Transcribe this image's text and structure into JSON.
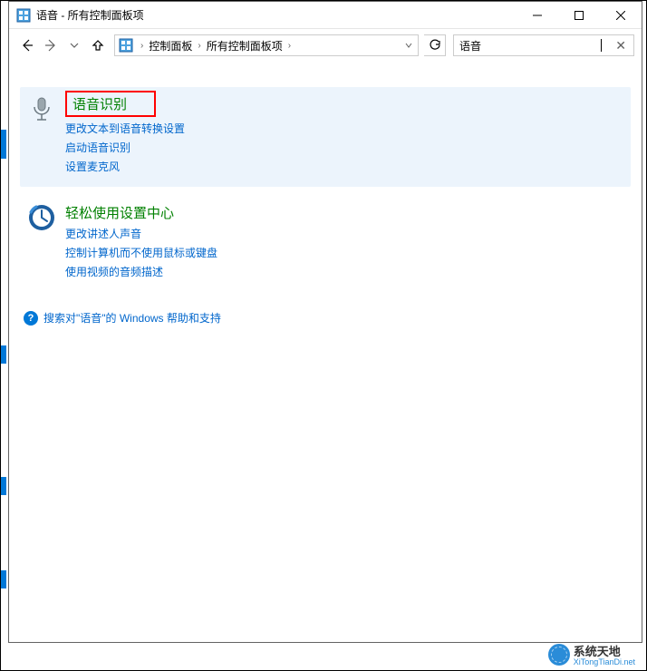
{
  "window": {
    "title": "语音 - 所有控制面板项"
  },
  "nav": {
    "crumbs": [
      "控制面板",
      "所有控制面板项"
    ],
    "search_value": "语音"
  },
  "results": [
    {
      "id": "speech-recognition",
      "title": "语音识别",
      "highlighted": true,
      "title_boxed": true,
      "icon": "microphone",
      "links": [
        "更改文本到语音转换设置",
        "启动语音识别",
        "设置麦克风"
      ]
    },
    {
      "id": "ease-of-access",
      "title": "轻松使用设置中心",
      "highlighted": false,
      "title_boxed": false,
      "icon": "ease-clock",
      "links": [
        "更改讲述人声音",
        "控制计算机而不使用鼠标或键盘",
        "使用视频的音频描述"
      ]
    }
  ],
  "help": {
    "text": "搜索对\"语音\"的 Windows 帮助和支持"
  },
  "watermark": {
    "cn": "系统天地",
    "en": "XiTongTianDi.net"
  }
}
